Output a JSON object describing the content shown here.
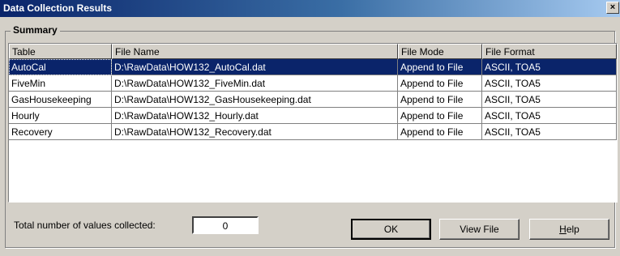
{
  "window": {
    "title": "Data Collection Results",
    "close_symbol": "×"
  },
  "summary": {
    "label": "Summary"
  },
  "table": {
    "columns": [
      "Table",
      "File Name",
      "File Mode",
      "File Format"
    ],
    "rows": [
      [
        "AutoCal",
        "D:\\RawData\\HOW132_AutoCal.dat",
        "Append to File",
        "ASCII, TOA5"
      ],
      [
        "FiveMin",
        "D:\\RawData\\HOW132_FiveMin.dat",
        "Append to File",
        "ASCII, TOA5"
      ],
      [
        "GasHousekeeping",
        "D:\\RawData\\HOW132_GasHousekeeping.dat",
        "Append to File",
        "ASCII, TOA5"
      ],
      [
        "Hourly",
        "D:\\RawData\\HOW132_Hourly.dat",
        "Append to File",
        "ASCII, TOA5"
      ],
      [
        "Recovery",
        "D:\\RawData\\HOW132_Recovery.dat",
        "Append to File",
        "ASCII, TOA5"
      ]
    ],
    "selected_row": 0
  },
  "footer": {
    "total_label": "Total number of values collected:",
    "total_value": "0",
    "ok_label": "OK",
    "view_file_label": "View File",
    "help_label": "Help"
  },
  "colors": {
    "titlebar": "#0a246a",
    "selection": "#0a246a",
    "face": "#d4d0c8"
  }
}
